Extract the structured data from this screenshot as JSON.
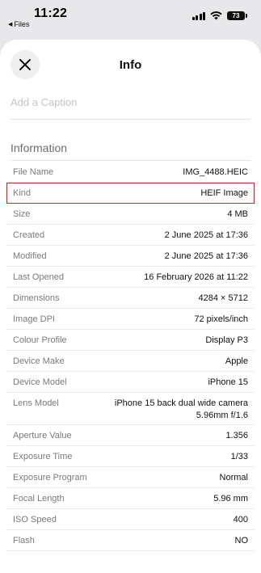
{
  "status_bar": {
    "time": "11:22",
    "back_app": "Files",
    "battery": "73"
  },
  "sheet": {
    "title": "Info",
    "caption_placeholder": "Add a Caption"
  },
  "information": {
    "header": "Information",
    "rows": [
      {
        "label": "File Name",
        "value": "IMG_4488.HEIC"
      },
      {
        "label": "Kind",
        "value": "HEIF Image"
      },
      {
        "label": "Size",
        "value": "4 MB"
      },
      {
        "label": "Created",
        "value": "2 June 2025 at 17:36"
      },
      {
        "label": "Modified",
        "value": "2 June 2025 at 17:36"
      },
      {
        "label": "Last Opened",
        "value": "16 February 2026 at 11:22"
      },
      {
        "label": "Dimensions",
        "value": "4284 × 5712"
      },
      {
        "label": "Image DPI",
        "value": "72 pixels/inch"
      },
      {
        "label": "Colour Profile",
        "value": "Display P3"
      },
      {
        "label": "Device Make",
        "value": "Apple"
      },
      {
        "label": "Device Model",
        "value": "iPhone 15"
      },
      {
        "label": "Lens Model",
        "value": "iPhone 15 back dual wide camera",
        "value2": "5.96mm f/1.6"
      },
      {
        "label": "Aperture Value",
        "value": "1.356"
      },
      {
        "label": "Exposure Time",
        "value": "1/33"
      },
      {
        "label": "Exposure Program",
        "value": "Normal"
      },
      {
        "label": "Focal Length",
        "value": "5.96 mm"
      },
      {
        "label": "ISO Speed",
        "value": "400"
      },
      {
        "label": "Flash",
        "value": "NO"
      }
    ]
  },
  "colors": {
    "highlight_border": "#c0262e",
    "sheet_background": "#ffffff",
    "page_background": "#e8e8ea"
  }
}
